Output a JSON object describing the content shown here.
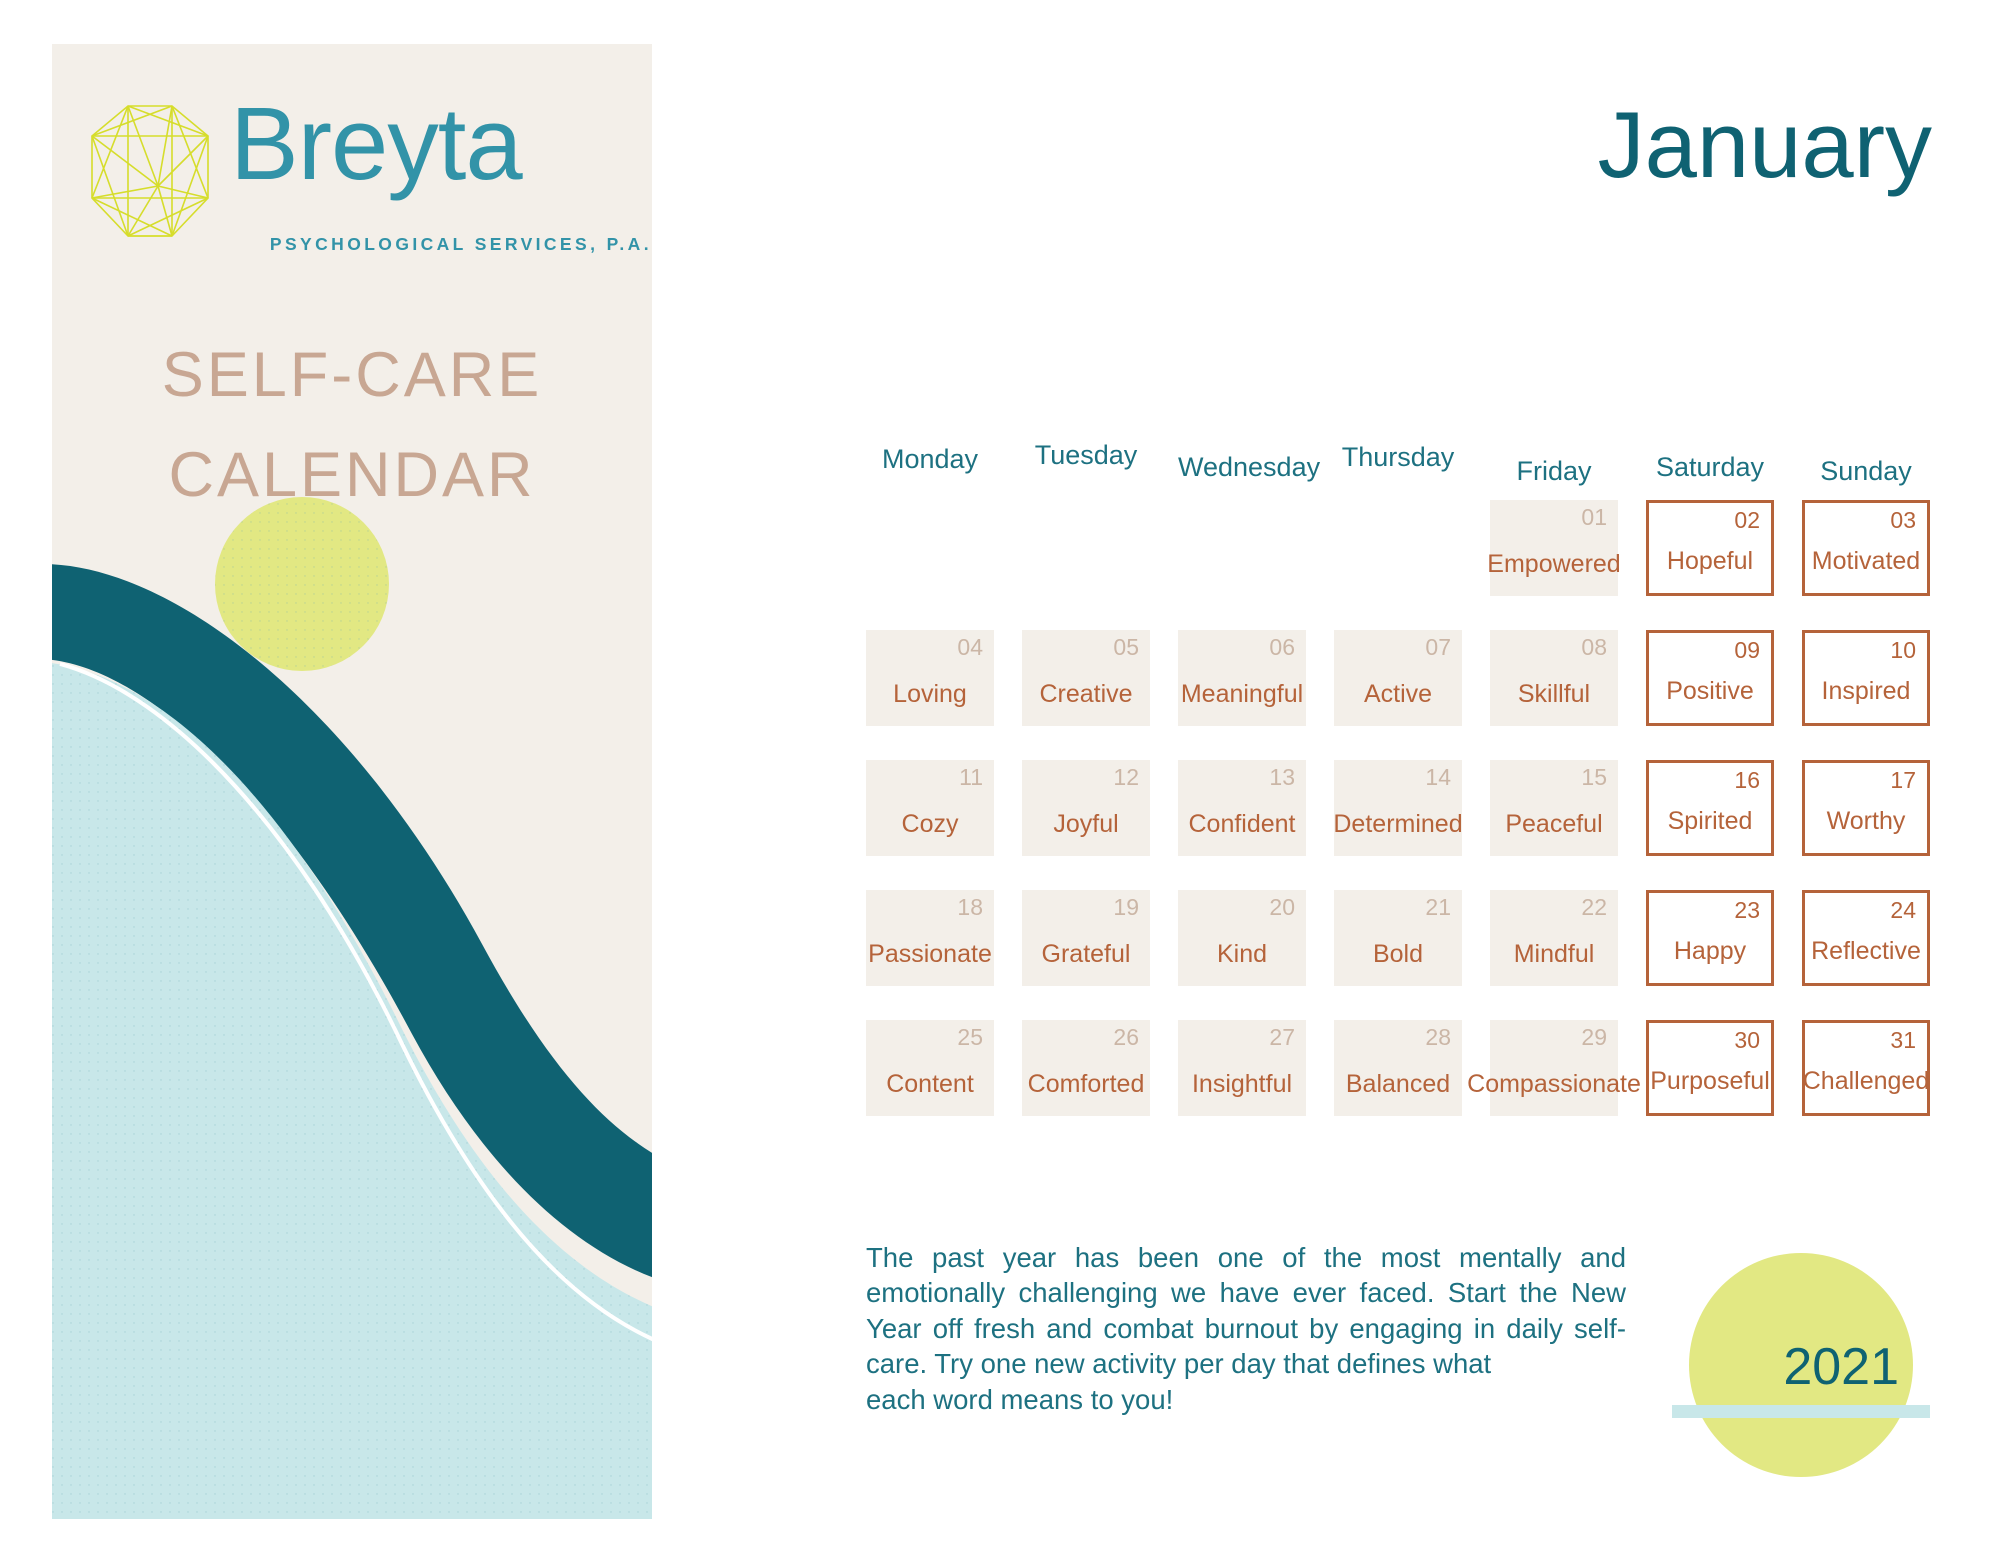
{
  "brand": {
    "name": "Breyta",
    "tagline": "PSYCHOLOGICAL SERVICES, P.A.",
    "title_line1": "SELF-CARE",
    "title_line2": "CALENDAR",
    "logo_icon": "octagon-polyhedron-logo"
  },
  "colors": {
    "teal": "#0f6272",
    "teal_light": "#3293a8",
    "lime": "#e2e883",
    "mint": "#c8e7e9",
    "cream": "#f3efe9",
    "terracotta": "#b5633a",
    "tan": "#c8a793",
    "number_muted": "#cbb6a6"
  },
  "header": {
    "month": "January",
    "year": "2021"
  },
  "calendar": {
    "weekdays": [
      "Monday",
      "Tuesday",
      "Wednesday",
      "Thursday",
      "Friday",
      "Saturday",
      "Sunday"
    ],
    "weeks": [
      [
        {
          "day": "",
          "word": "",
          "type": "empty"
        },
        {
          "day": "",
          "word": "",
          "type": "empty"
        },
        {
          "day": "",
          "word": "",
          "type": "empty"
        },
        {
          "day": "",
          "word": "",
          "type": "empty"
        },
        {
          "day": "01",
          "word": "Empowered",
          "type": "weekday"
        },
        {
          "day": "02",
          "word": "Hopeful",
          "type": "weekend"
        },
        {
          "day": "03",
          "word": "Motivated",
          "type": "weekend"
        }
      ],
      [
        {
          "day": "04",
          "word": "Loving",
          "type": "weekday"
        },
        {
          "day": "05",
          "word": "Creative",
          "type": "weekday"
        },
        {
          "day": "06",
          "word": "Meaningful",
          "type": "weekday"
        },
        {
          "day": "07",
          "word": "Active",
          "type": "weekday"
        },
        {
          "day": "08",
          "word": "Skillful",
          "type": "weekday"
        },
        {
          "day": "09",
          "word": "Positive",
          "type": "weekend"
        },
        {
          "day": "10",
          "word": "Inspired",
          "type": "weekend"
        }
      ],
      [
        {
          "day": "11",
          "word": "Cozy",
          "type": "weekday"
        },
        {
          "day": "12",
          "word": "Joyful",
          "type": "weekday"
        },
        {
          "day": "13",
          "word": "Confident",
          "type": "weekday"
        },
        {
          "day": "14",
          "word": "Determined",
          "type": "weekday"
        },
        {
          "day": "15",
          "word": "Peaceful",
          "type": "weekday"
        },
        {
          "day": "16",
          "word": "Spirited",
          "type": "weekend"
        },
        {
          "day": "17",
          "word": "Worthy",
          "type": "weekend"
        }
      ],
      [
        {
          "day": "18",
          "word": "Passionate",
          "type": "weekday"
        },
        {
          "day": "19",
          "word": "Grateful",
          "type": "weekday"
        },
        {
          "day": "20",
          "word": "Kind",
          "type": "weekday"
        },
        {
          "day": "21",
          "word": "Bold",
          "type": "weekday"
        },
        {
          "day": "22",
          "word": "Mindful",
          "type": "weekday"
        },
        {
          "day": "23",
          "word": "Happy",
          "type": "weekend"
        },
        {
          "day": "24",
          "word": "Reflective",
          "type": "weekend"
        }
      ],
      [
        {
          "day": "25",
          "word": "Content",
          "type": "weekday"
        },
        {
          "day": "26",
          "word": "Comforted",
          "type": "weekday"
        },
        {
          "day": "27",
          "word": "Insightful",
          "type": "weekday"
        },
        {
          "day": "28",
          "word": "Balanced",
          "type": "weekday"
        },
        {
          "day": "29",
          "word": "Compassionate",
          "type": "weekday"
        },
        {
          "day": "30",
          "word": "Purposeful",
          "type": "weekend"
        },
        {
          "day": "31",
          "word": "Challenged",
          "type": "weekend"
        }
      ]
    ]
  },
  "blurb": {
    "text": "The past year has been one of the most mentally and emotionally challenging we have ever faced. Start the New Year off fresh and combat burnout by engaging in daily self-care. Try one new activity per day that defines what",
    "last_line": "each word means to you!"
  }
}
